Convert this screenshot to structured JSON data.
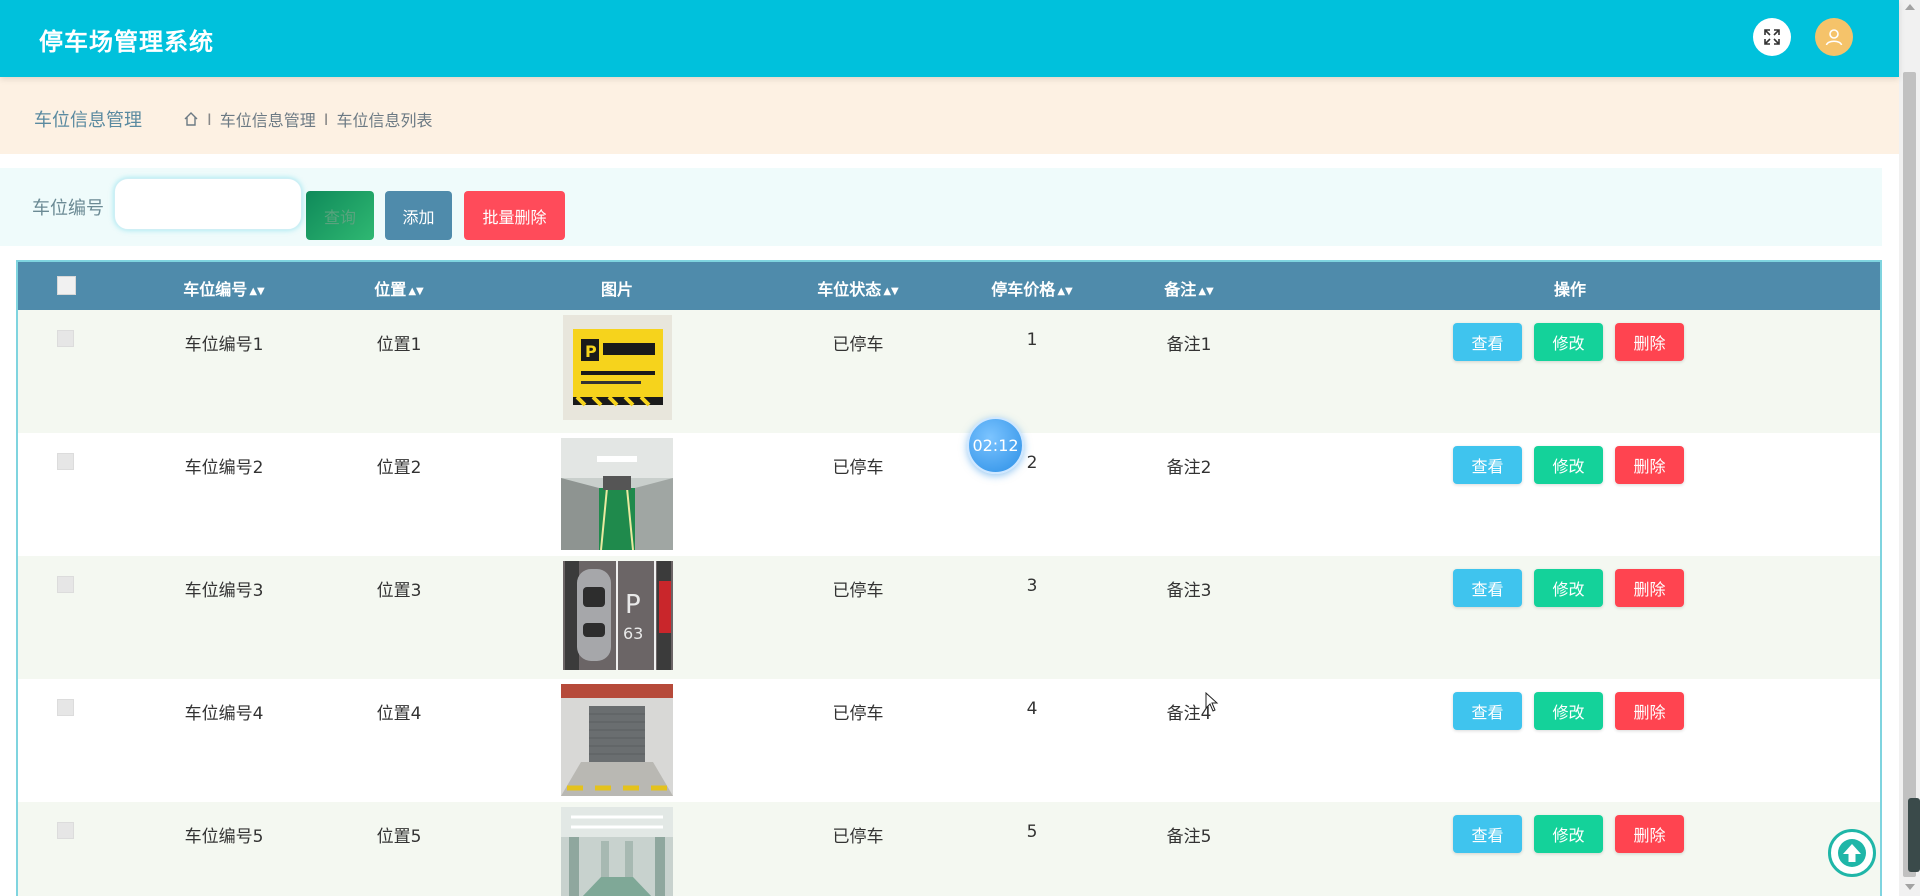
{
  "header": {
    "app_title": "停车场管理系统",
    "icons": [
      "fullscreen-icon",
      "user-icon"
    ]
  },
  "breadcrumb": {
    "title": "车位信息管理",
    "home_icon": "home-icon",
    "separator": "I",
    "path": [
      "车位信息管理",
      "车位信息列表"
    ]
  },
  "search": {
    "label": "车位编号",
    "input_value": "",
    "search_button": "查询",
    "add_button": "添加",
    "batch_delete_button": "批量删除"
  },
  "table": {
    "columns": [
      "车位编号",
      "位置",
      "图片",
      "车位状态",
      "停车价格",
      "备注",
      "操作"
    ],
    "sort_icon": "sort-icon",
    "rows": [
      {
        "code": "车位编号1",
        "location": "位置1",
        "image": "parking-sign-image",
        "status": "已停车",
        "price": "1",
        "remark": "备注1"
      },
      {
        "code": "车位编号2",
        "location": "位置2",
        "image": "garage-corridor-image",
        "status": "已停车",
        "price": "2",
        "remark": "备注2"
      },
      {
        "code": "车位编号3",
        "location": "位置3",
        "image": "parking-space-p63-image",
        "status": "已停车",
        "price": "3",
        "remark": "备注3"
      },
      {
        "code": "车位编号4",
        "location": "位置4",
        "image": "garage-door-image",
        "status": "已停车",
        "price": "4",
        "remark": "备注4"
      },
      {
        "code": "车位编号5",
        "location": "位置5",
        "image": "underground-garage-image",
        "status": "已停车",
        "price": "5",
        "remark": "备注5"
      }
    ],
    "actions": {
      "view": "查看",
      "edit": "修改",
      "delete": "删除"
    }
  },
  "overlay": {
    "timer": "02:12",
    "back_to_top_icon": "arrow-up-icon"
  },
  "colors": {
    "header_bg": "#00c1dc",
    "breadcrumb_bg": "#fdf1e3",
    "table_header_bg": "#4f8bab",
    "view_btn": "#3fc4ee",
    "edit_btn": "#14d29a",
    "delete_btn": "#ff4450"
  }
}
